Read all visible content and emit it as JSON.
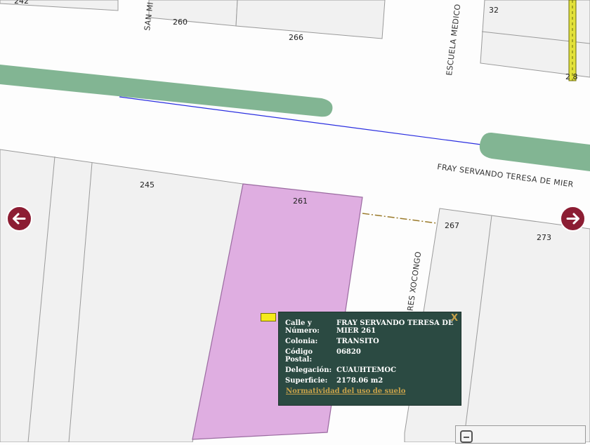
{
  "map": {
    "street_labels": {
      "main": "FRAY SERVANDO TERESA DE MIER",
      "escuela": "ESCUELA MEDICO",
      "san_mi": "SAN MI",
      "xocongo": "ANTONIO ANDRES XOCONGO"
    },
    "lot_numbers": {
      "l242": "242",
      "l260": "260",
      "l266": "266",
      "l32": "32",
      "l2x8": "2 8",
      "l245": "245",
      "l261": "261",
      "l267": "267",
      "l273": "273"
    },
    "colors": {
      "selected_parcel": "#dfaee1",
      "median": "#82b593",
      "popup_bg": "#2b4a42",
      "nav_button": "#8c1d33",
      "link": "#c8a24a"
    }
  },
  "popup": {
    "close_label": "X",
    "rows": [
      {
        "label": "Calle y Número:",
        "value": "FRAY SERVANDO TERESA DE MIER 261"
      },
      {
        "label": "Colonia:",
        "value": "TRANSITO"
      },
      {
        "label": "Código Postal:",
        "value": "06820"
      },
      {
        "label": "Delegación:",
        "value": "CUAUHTEMOC"
      },
      {
        "label": "Superficie:",
        "value": "2178.06 m2"
      }
    ],
    "link_label": "Normatividad del uso de suelo"
  },
  "nav": {
    "prev_icon": "arrow-left-icon",
    "next_icon": "arrow-right-icon"
  }
}
